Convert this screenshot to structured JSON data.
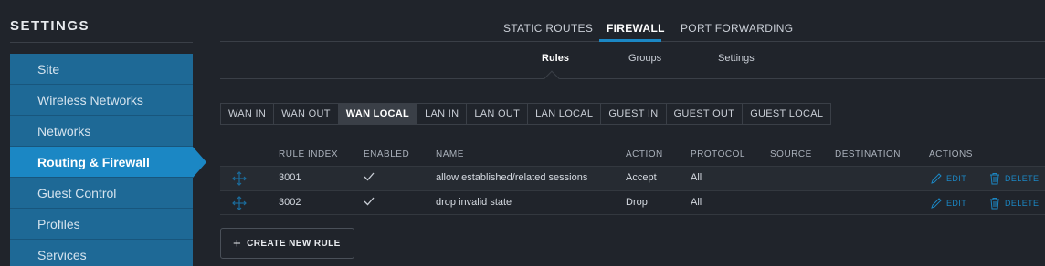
{
  "sidebar": {
    "title": "SETTINGS",
    "items": [
      {
        "label": "Site"
      },
      {
        "label": "Wireless Networks"
      },
      {
        "label": "Networks"
      },
      {
        "label": "Routing & Firewall",
        "active": true
      },
      {
        "label": "Guest Control"
      },
      {
        "label": "Profiles"
      },
      {
        "label": "Services"
      }
    ]
  },
  "top_tabs": [
    {
      "label": "STATIC ROUTES"
    },
    {
      "label": "FIREWALL",
      "active": true
    },
    {
      "label": "PORT FORWARDING"
    }
  ],
  "sub_tabs": [
    {
      "label": "Rules",
      "active": true
    },
    {
      "label": "Groups"
    },
    {
      "label": "Settings"
    }
  ],
  "rule_sets": [
    {
      "label": "WAN IN"
    },
    {
      "label": "WAN OUT"
    },
    {
      "label": "WAN LOCAL",
      "active": true
    },
    {
      "label": "LAN IN"
    },
    {
      "label": "LAN OUT"
    },
    {
      "label": "LAN LOCAL"
    },
    {
      "label": "GUEST IN"
    },
    {
      "label": "GUEST OUT"
    },
    {
      "label": "GUEST LOCAL"
    }
  ],
  "table": {
    "headers": {
      "rule_index": "RULE INDEX",
      "enabled": "ENABLED",
      "name": "NAME",
      "action": "ACTION",
      "protocol": "PROTOCOL",
      "source": "SOURCE",
      "destination": "DESTINATION",
      "actions": "ACTIONS"
    },
    "rows": [
      {
        "rule_index": "3001",
        "enabled": true,
        "name": "allow established/related sessions",
        "action": "Accept",
        "protocol": "All",
        "source": "",
        "destination": ""
      },
      {
        "rule_index": "3002",
        "enabled": true,
        "name": "drop invalid state",
        "action": "Drop",
        "protocol": "All",
        "source": "",
        "destination": ""
      }
    ],
    "edit_label": "EDIT",
    "delete_label": "DELETE"
  },
  "create_button": {
    "label": "CREATE NEW RULE"
  },
  "colors": {
    "accent": "#1b87c4",
    "background": "#20242b",
    "sidebar_item": "#1e6996"
  }
}
